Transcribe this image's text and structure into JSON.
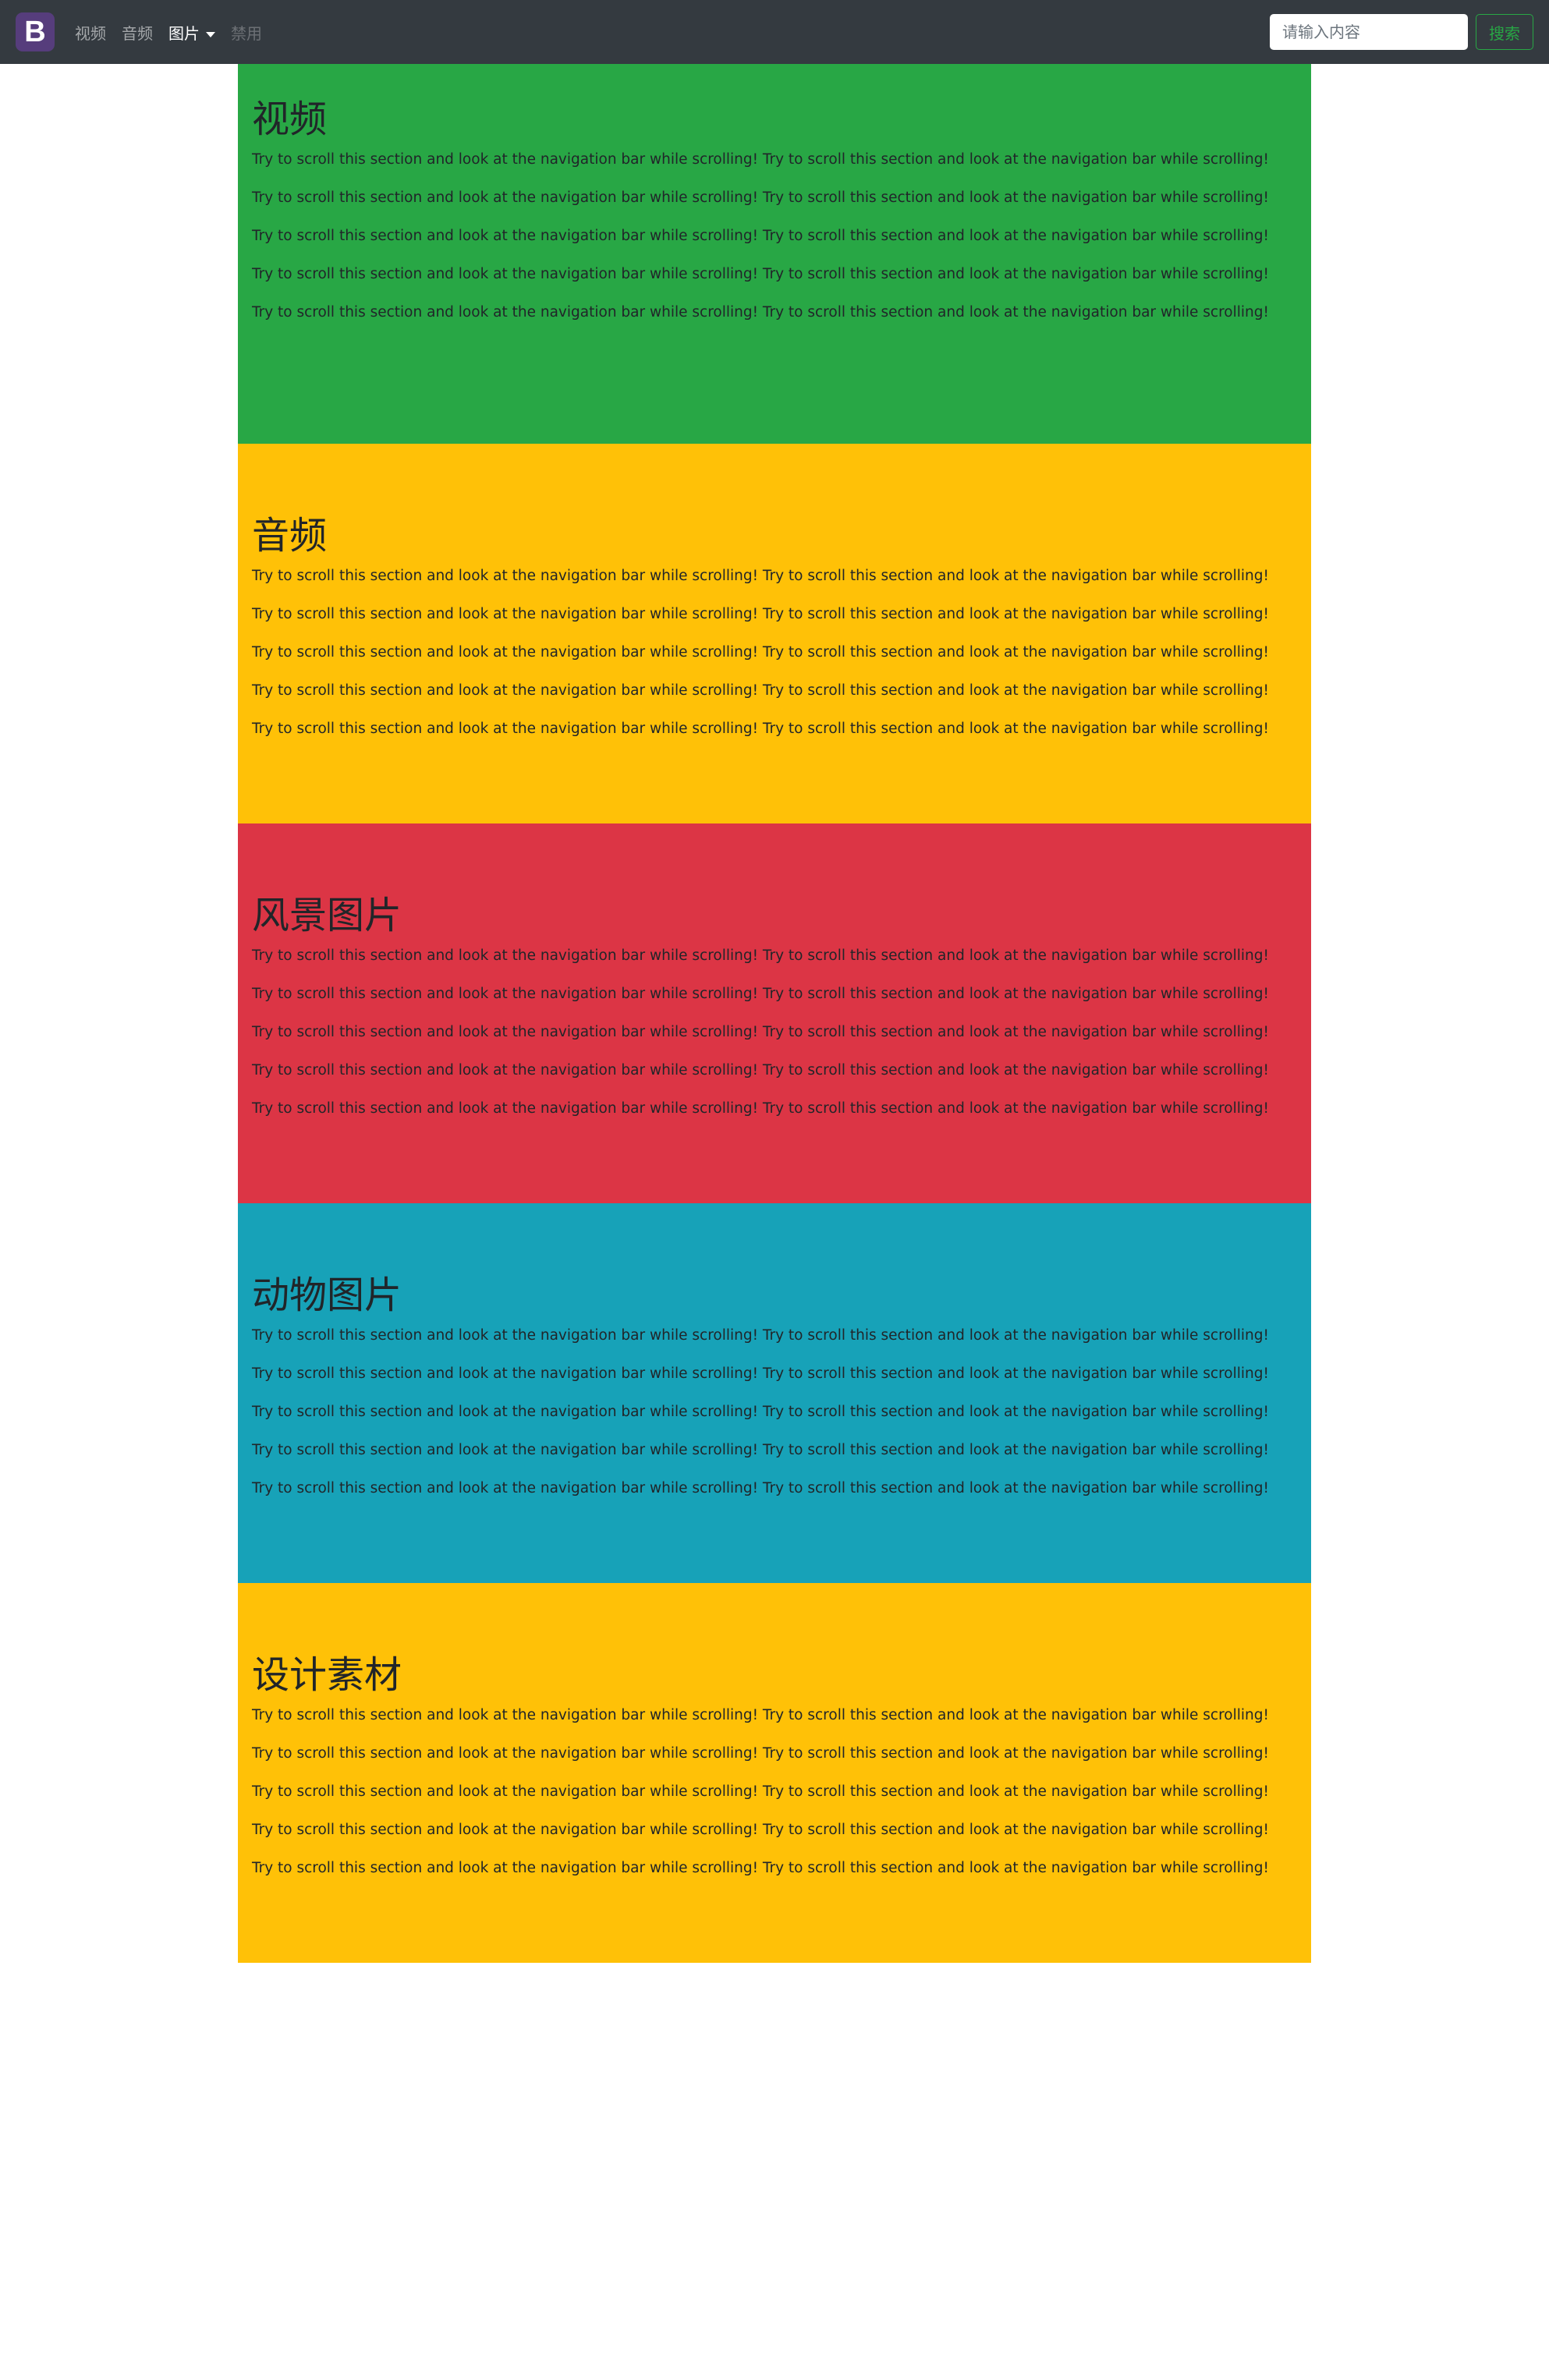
{
  "colors": {
    "navbar_bg": "#343a40",
    "brand_bg": "#563d7c",
    "search_accent": "#28a745",
    "green": "#28a745",
    "yellow": "#ffc107",
    "red": "#dc3545",
    "teal": "#17a2b8"
  },
  "navbar": {
    "brand_letter": "B",
    "links": [
      {
        "label": "视频"
      },
      {
        "label": "音频"
      },
      {
        "label": "图片",
        "icon": "chevron-down-icon"
      },
      {
        "label": "禁用"
      }
    ],
    "search": {
      "placeholder": "请输入内容",
      "button_label": "搜索"
    }
  },
  "sections": [
    {
      "heading": "视频",
      "color": "#28a745",
      "paragraphs": [
        "Try to scroll this section and look at the navigation bar while scrolling! Try to scroll this section and look at the navigation bar while scrolling!",
        "Try to scroll this section and look at the navigation bar while scrolling! Try to scroll this section and look at the navigation bar while scrolling!",
        "Try to scroll this section and look at the navigation bar while scrolling! Try to scroll this section and look at the navigation bar while scrolling!",
        "Try to scroll this section and look at the navigation bar while scrolling! Try to scroll this section and look at the navigation bar while scrolling!",
        "Try to scroll this section and look at the navigation bar while scrolling! Try to scroll this section and look at the navigation bar while scrolling!"
      ]
    },
    {
      "heading": "音频",
      "color": "#ffc107",
      "paragraphs": [
        "Try to scroll this section and look at the navigation bar while scrolling! Try to scroll this section and look at the navigation bar while scrolling!",
        "Try to scroll this section and look at the navigation bar while scrolling! Try to scroll this section and look at the navigation bar while scrolling!",
        "Try to scroll this section and look at the navigation bar while scrolling! Try to scroll this section and look at the navigation bar while scrolling!",
        "Try to scroll this section and look at the navigation bar while scrolling! Try to scroll this section and look at the navigation bar while scrolling!",
        "Try to scroll this section and look at the navigation bar while scrolling! Try to scroll this section and look at the navigation bar while scrolling!"
      ]
    },
    {
      "heading": "风景图片",
      "color": "#dc3545",
      "paragraphs": [
        "Try to scroll this section and look at the navigation bar while scrolling! Try to scroll this section and look at the navigation bar while scrolling!",
        "Try to scroll this section and look at the navigation bar while scrolling! Try to scroll this section and look at the navigation bar while scrolling!",
        "Try to scroll this section and look at the navigation bar while scrolling! Try to scroll this section and look at the navigation bar while scrolling!",
        "Try to scroll this section and look at the navigation bar while scrolling! Try to scroll this section and look at the navigation bar while scrolling!",
        "Try to scroll this section and look at the navigation bar while scrolling! Try to scroll this section and look at the navigation bar while scrolling!"
      ]
    },
    {
      "heading": "动物图片",
      "color": "#17a2b8",
      "paragraphs": [
        "Try to scroll this section and look at the navigation bar while scrolling! Try to scroll this section and look at the navigation bar while scrolling!",
        "Try to scroll this section and look at the navigation bar while scrolling! Try to scroll this section and look at the navigation bar while scrolling!",
        "Try to scroll this section and look at the navigation bar while scrolling! Try to scroll this section and look at the navigation bar while scrolling!",
        "Try to scroll this section and look at the navigation bar while scrolling! Try to scroll this section and look at the navigation bar while scrolling!",
        "Try to scroll this section and look at the navigation bar while scrolling! Try to scroll this section and look at the navigation bar while scrolling!"
      ]
    },
    {
      "heading": "设计素材",
      "color": "#ffc107",
      "paragraphs": [
        "Try to scroll this section and look at the navigation bar while scrolling! Try to scroll this section and look at the navigation bar while scrolling!",
        "Try to scroll this section and look at the navigation bar while scrolling! Try to scroll this section and look at the navigation bar while scrolling!",
        "Try to scroll this section and look at the navigation bar while scrolling! Try to scroll this section and look at the navigation bar while scrolling!",
        "Try to scroll this section and look at the navigation bar while scrolling! Try to scroll this section and look at the navigation bar while scrolling!",
        "Try to scroll this section and look at the navigation bar while scrolling! Try to scroll this section and look at the navigation bar while scrolling!"
      ]
    }
  ]
}
